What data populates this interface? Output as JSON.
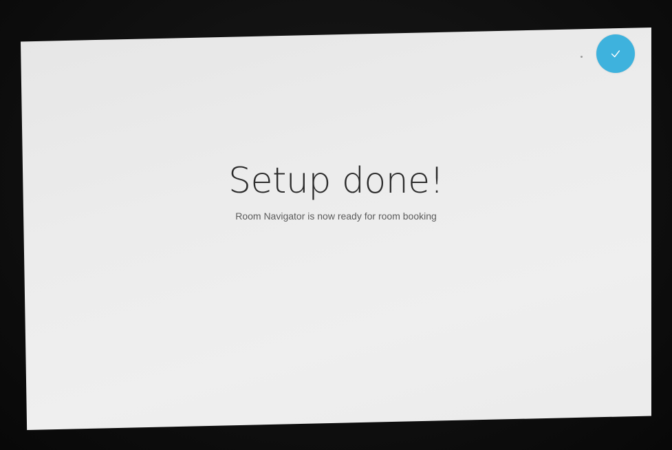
{
  "screen": {
    "title": "Setup done!",
    "subtitle": "Room Navigator is now ready for room booking",
    "confirm_icon": "checkmark-icon"
  },
  "colors": {
    "accent": "#3eb2dd",
    "background": "#ececec",
    "title_text": "#2b2b2b"
  }
}
